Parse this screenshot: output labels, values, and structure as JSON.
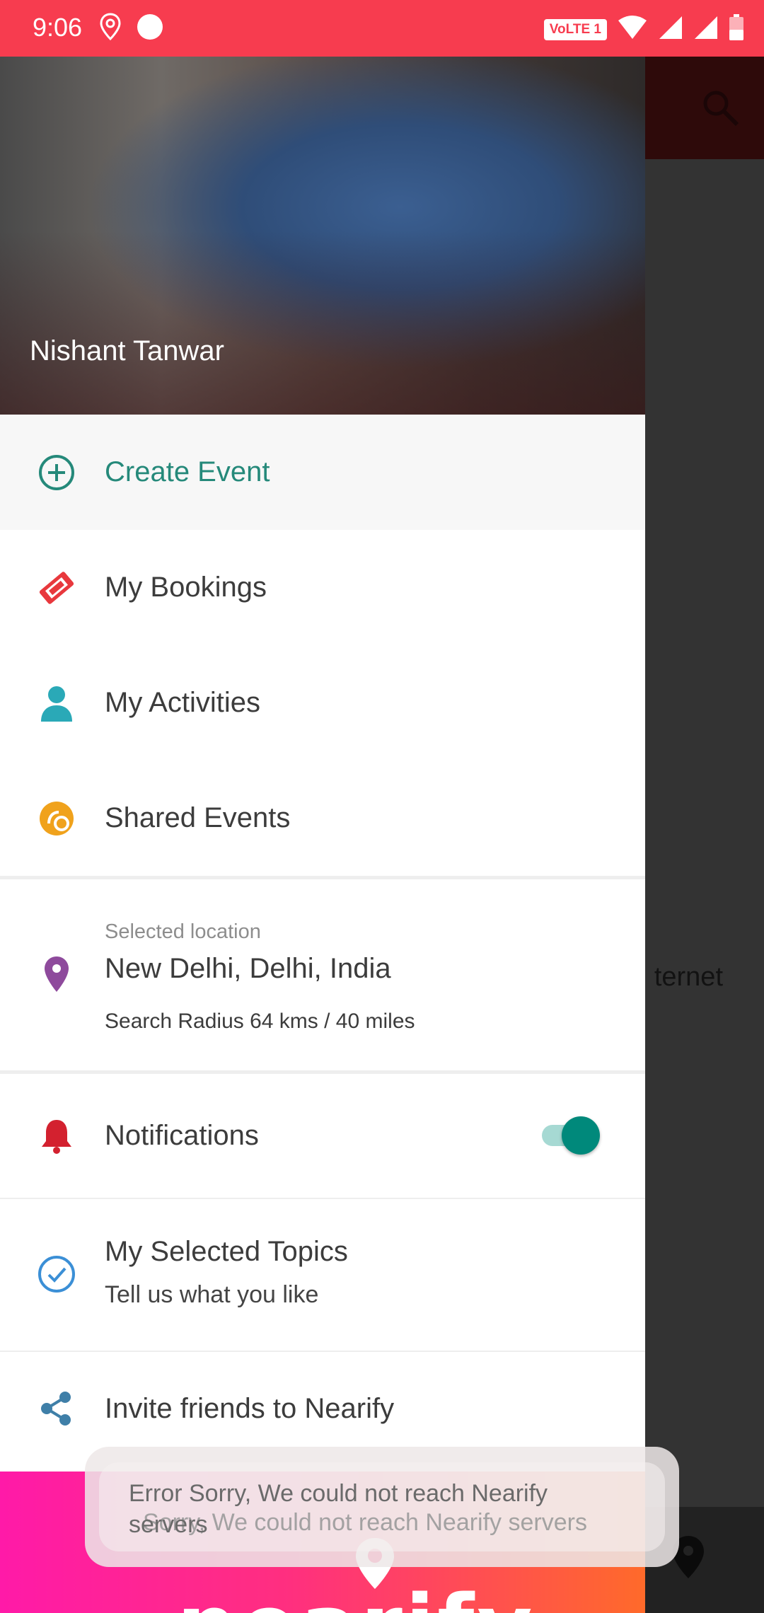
{
  "status_bar": {
    "time": "9:06",
    "network_badge": "VoLTE 1",
    "color": "#f73c4f"
  },
  "background": {
    "partial_text": "ternet"
  },
  "drawer": {
    "profile_name": "Nishant Tanwar",
    "items": [
      {
        "label": "Create Event",
        "icon": "add-circle-icon",
        "color": "#25897a"
      },
      {
        "label": "My Bookings",
        "icon": "ticket-icon",
        "color": "#e8383d"
      },
      {
        "label": "My Activities",
        "icon": "person-icon",
        "color": "#2aa9b7"
      },
      {
        "label": "Shared Events",
        "icon": "shared-events-icon",
        "color": "#f0a21c"
      }
    ],
    "location": {
      "caption": "Selected location",
      "value": "New Delhi, Delhi, India",
      "radius": "Search Radius 64 kms / 40 miles",
      "icon": "location-pin-icon",
      "color": "#8e4a9c"
    },
    "notifications": {
      "label": "Notifications",
      "enabled": true,
      "icon": "bell-icon",
      "color": "#d3212f"
    },
    "topics": {
      "title": "My Selected Topics",
      "subtitle": "Tell us what you like",
      "icon": "check-circle-icon",
      "color": "#3b8fd6"
    },
    "invite": {
      "label": "Invite friends to Nearify",
      "icon": "share-icon",
      "color": "#3f7fa8"
    }
  },
  "toast": {
    "line_front": "Error Sorry, We could not reach Nearify servers",
    "line_back": "Sorry, We could not reach Nearify servers"
  },
  "brand": {
    "wordmark": "nearify"
  }
}
